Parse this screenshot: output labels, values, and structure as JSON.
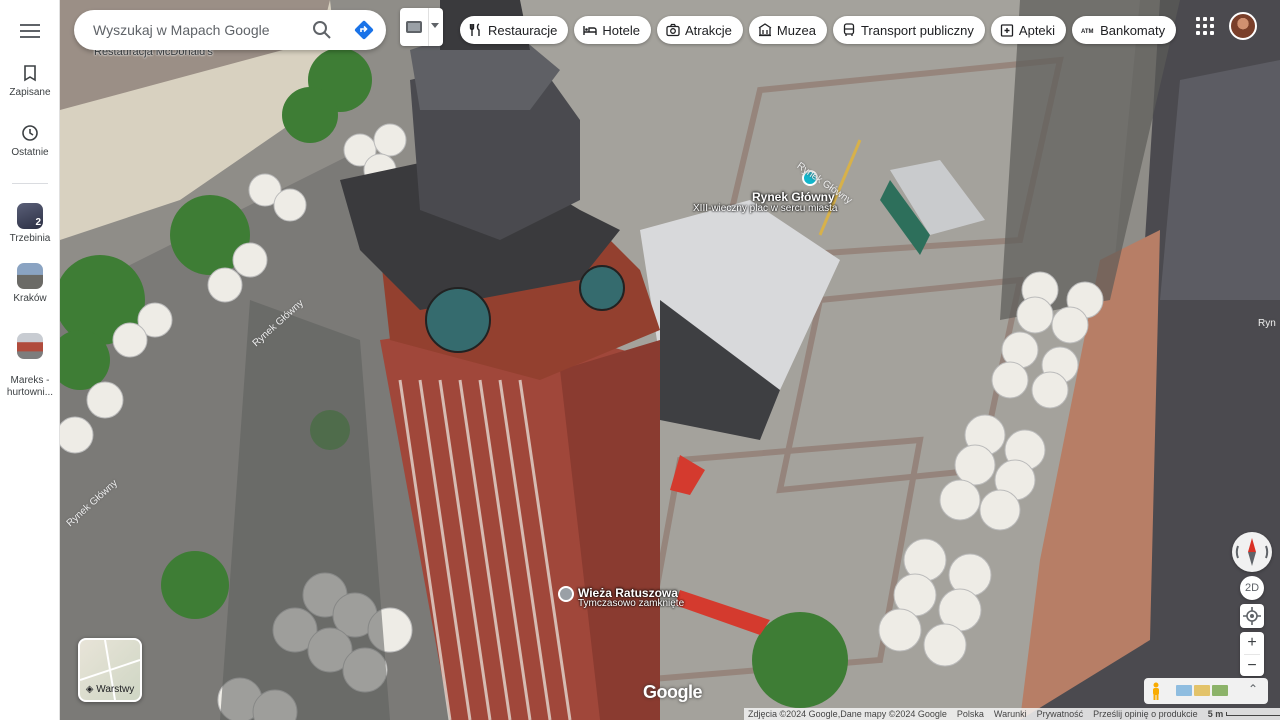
{
  "search": {
    "placeholder": "Wyszukaj w Mapach Google"
  },
  "rail": {
    "saved_label": "Zapisane",
    "recent_label": "Ostatnie",
    "recent_places": [
      {
        "label": "Trzebinia",
        "badge": "2"
      },
      {
        "label": "Kraków"
      },
      {
        "label": "Mareks -\nhurtowni..."
      }
    ]
  },
  "chips": [
    {
      "label": "Restauracje",
      "icon": "fork-knife-icon"
    },
    {
      "label": "Hotele",
      "icon": "bed-icon"
    },
    {
      "label": "Atrakcje",
      "icon": "camera-icon"
    },
    {
      "label": "Muzea",
      "icon": "museum-icon"
    },
    {
      "label": "Transport publiczny",
      "icon": "bus-icon"
    },
    {
      "label": "Apteki",
      "icon": "pharmacy-icon"
    },
    {
      "label": "Bankomaty",
      "icon": "atm-icon"
    }
  ],
  "map_labels": {
    "mcdonalds": "Restauracja McDonald's",
    "rynek_title": "Rynek Główny",
    "rynek_sub": "XIII-wieczny plac w sercu miasta",
    "wieza_title": "Wieża Ratuszowa",
    "wieza_sub": "Tymczasowo zamknięte",
    "road_1": "Rynek Główny",
    "road_2": "Rynek Główny",
    "road_3": "Rynek Główny",
    "road_edge": "Ryn"
  },
  "layers_label": "Warstwy",
  "google_logo": "Google",
  "btn_2d": "2D",
  "footer": {
    "credits": "Zdjęcia ©2024 Google,Dane mapy ©2024 Google",
    "country": "Polska",
    "terms": "Warunki",
    "privacy": "Prywatność",
    "feedback": "Prześlij opinię o produkcie",
    "scale": "5 m"
  },
  "colors": {
    "accent": "#1a73e8",
    "poi_teal": "#12b5cb"
  }
}
